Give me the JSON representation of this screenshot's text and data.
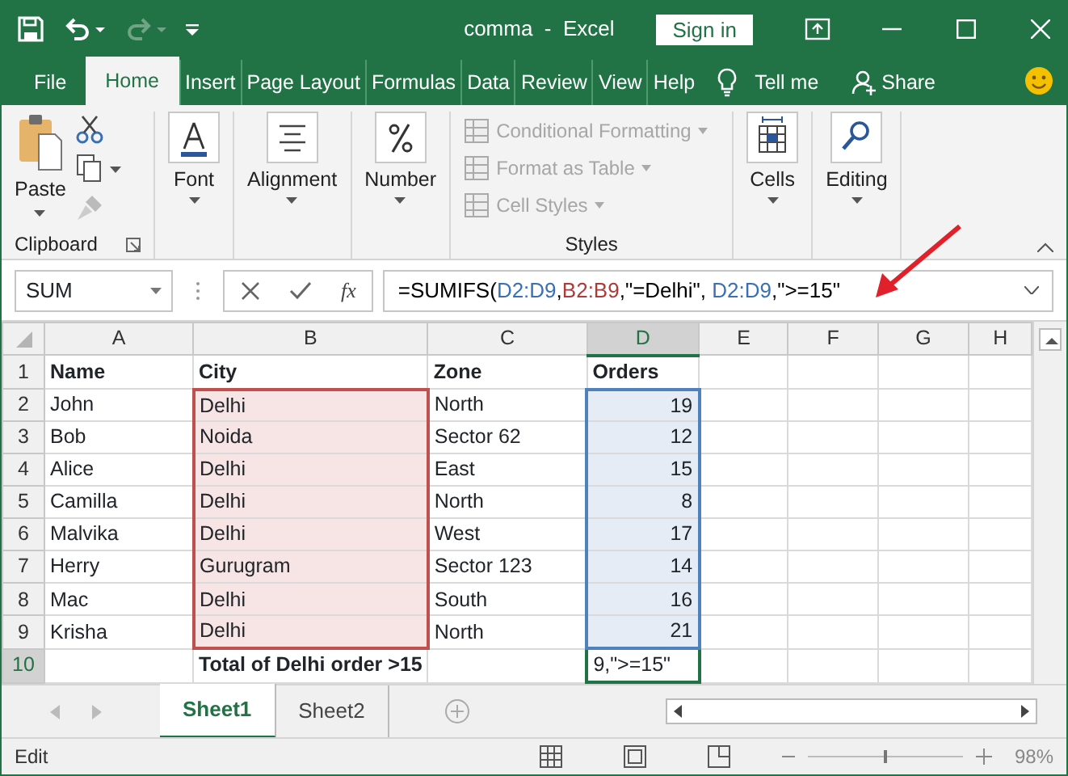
{
  "window": {
    "title": "comma  -  Excel",
    "sign_in": "Sign in"
  },
  "quick_access": [
    {
      "kind": "save",
      "disabled": false
    },
    {
      "kind": "undo",
      "disabled": false
    },
    {
      "kind": "redo",
      "disabled": true
    }
  ],
  "tabs": [
    {
      "label": "File",
      "selected": false
    },
    {
      "label": "Home",
      "selected": true
    },
    {
      "label": "Insert",
      "selected": false
    },
    {
      "label": "Page Layout",
      "selected": false
    },
    {
      "label": "Formulas",
      "selected": false
    },
    {
      "label": "Data",
      "selected": false
    },
    {
      "label": "Review",
      "selected": false
    },
    {
      "label": "View",
      "selected": false
    },
    {
      "label": "Help",
      "selected": false
    }
  ],
  "tell_me": "Tell me",
  "share": "Share",
  "ribbon": {
    "clipboard": {
      "paste": "Paste",
      "label": "Clipboard"
    },
    "big_buttons": [
      {
        "label": "Font",
        "kind": "font"
      },
      {
        "label": "Alignment",
        "kind": "align"
      },
      {
        "label": "Number",
        "kind": "number"
      }
    ],
    "styles": {
      "items": [
        {
          "label": "Conditional Formatting",
          "disabled": true
        },
        {
          "label": "Format as Table",
          "disabled": true
        },
        {
          "label": "Cell Styles",
          "disabled": true
        }
      ],
      "label": "Styles"
    },
    "right_buttons": [
      {
        "label": "Cells",
        "kind": "cells"
      },
      {
        "label": "Editing",
        "kind": "editing"
      }
    ]
  },
  "formula_bar": {
    "name_box": "SUM",
    "fx": "fx",
    "segments": [
      {
        "text": "=SUMIFS(",
        "color": "#000000"
      },
      {
        "text": "D2:D9",
        "color": "#3a6fb4"
      },
      {
        "text": ",",
        "color": "#000000"
      },
      {
        "text": "B2:B9",
        "color": "#b03a37"
      },
      {
        "text": ",\"=Delhi\", ",
        "color": "#000000"
      },
      {
        "text": "D2:D9",
        "color": "#3a6fb4"
      },
      {
        "text": ",\">=15\"",
        "color": "#000000"
      }
    ]
  },
  "columns": [
    {
      "label": "A",
      "selected": false
    },
    {
      "label": "B",
      "selected": false,
      "color": "#c0504d"
    },
    {
      "label": "C",
      "selected": false
    },
    {
      "label": "D",
      "selected": true,
      "color": "#4f81bd",
      "numeric": true
    },
    {
      "label": "E",
      "selected": false
    },
    {
      "label": "F",
      "selected": false
    },
    {
      "label": "G",
      "selected": false
    },
    {
      "label": "H",
      "selected": false
    }
  ],
  "rows": [
    {
      "number": "1",
      "selected": false,
      "in_range": false,
      "cells": [
        {
          "text": "Name",
          "bold": true
        },
        {
          "text": "City",
          "bold": true
        },
        {
          "text": "Zone",
          "bold": true
        },
        {
          "text": "Orders",
          "bold": true
        }
      ]
    },
    {
      "number": "2",
      "selected": false,
      "in_range": true,
      "cells": [
        "John",
        "Delhi",
        "North",
        "19"
      ]
    },
    {
      "number": "3",
      "selected": false,
      "in_range": true,
      "cells": [
        "Bob",
        "Noida",
        "Sector 62",
        "12"
      ]
    },
    {
      "number": "4",
      "selected": false,
      "in_range": true,
      "cells": [
        "Alice",
        "Delhi",
        "East",
        "15"
      ]
    },
    {
      "number": "5",
      "selected": false,
      "in_range": true,
      "cells": [
        "Camilla",
        "Delhi",
        "North",
        "8"
      ]
    },
    {
      "number": "6",
      "selected": false,
      "in_range": true,
      "cells": [
        "Malvika",
        "Delhi",
        "West",
        "17"
      ]
    },
    {
      "number": "7",
      "selected": false,
      "in_range": true,
      "cells": [
        "Herry",
        "Gurugram",
        "Sector 123",
        "14"
      ]
    },
    {
      "number": "8",
      "selected": false,
      "in_range": true,
      "cells": [
        "Mac",
        "Delhi",
        "South",
        "16"
      ]
    },
    {
      "number": "9",
      "selected": false,
      "in_range": true,
      "cells": [
        "Krisha",
        "Delhi",
        "North",
        "21"
      ]
    },
    {
      "number": "10",
      "selected": true,
      "in_range": false,
      "cells": [
        "",
        {
          "text": "Total of Delhi order >15",
          "bold": true
        },
        "",
        "9,\">=15\""
      ]
    }
  ],
  "sheets": [
    {
      "label": "Sheet1",
      "selected": true
    },
    {
      "label": "Sheet2",
      "selected": false
    }
  ],
  "status_bar": {
    "mode": "Edit",
    "zoom_slider": {
      "level": 0.5
    },
    "zoom": "98%"
  }
}
